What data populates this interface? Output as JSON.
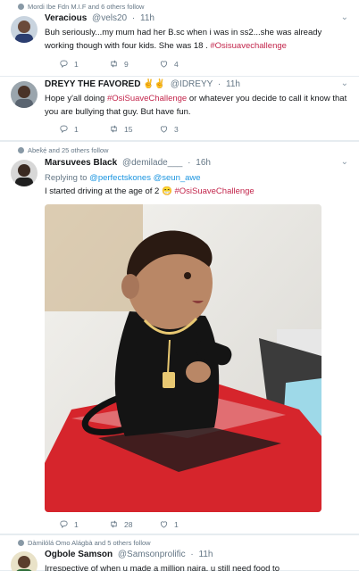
{
  "tweets": [
    {
      "social": "Mordi Ibe Fdn M.I.F and 6 others follow",
      "name": "Veracious",
      "handle": "@vels20",
      "time": "11h",
      "text_a": "Buh seriously...my mum had her B.sc when i was in ss2...she was already working though with four kids. She was 18 .",
      "hashtag": "#Osisuavechallenge",
      "replies": "1",
      "retweets": "9",
      "likes": "4"
    },
    {
      "name": "DREYY THE FAVORED",
      "emoji": "✌✌",
      "handle": "@IDREYY",
      "time": "11h",
      "text_a": "Hope y'all doing ",
      "hashtag": "#OsiSuaveChallenge",
      "text_b": " or whatever you decide to call it know that you are bullying that guy. But have fun.",
      "replies": "1",
      "retweets": "15",
      "likes": "3"
    },
    {
      "social": "Abek̀ẹ́ and 25 others follow",
      "name": "Marsuvees Black",
      "handle": "@demilade___",
      "time": "16h",
      "replying_prefix": "Replying to ",
      "reply_to_1": "@perfectskones",
      "reply_to_2": "@seun_awe",
      "text_a": "I started driving at the age of 2 ",
      "emoji": "😁",
      "hashtag": "#OsiSuaveChallenge",
      "replies": "1",
      "retweets": "28",
      "likes": "1"
    },
    {
      "social": "Dàmilólá Omo Alágbà and 5 others follow",
      "name": "Ogbole Samson",
      "handle": "@Samsonprolific",
      "time": "11h",
      "text_a": "Irrespective of when u made a million naira, u still need food to"
    }
  ],
  "colors": {
    "hashtag": "#c3264c",
    "link": "#1b95e0",
    "muted": "#657786",
    "divider": "#e6ecf0"
  },
  "icons": [
    "reply-icon",
    "retweet-icon",
    "like-icon",
    "more-caret-icon",
    "person-icon"
  ]
}
